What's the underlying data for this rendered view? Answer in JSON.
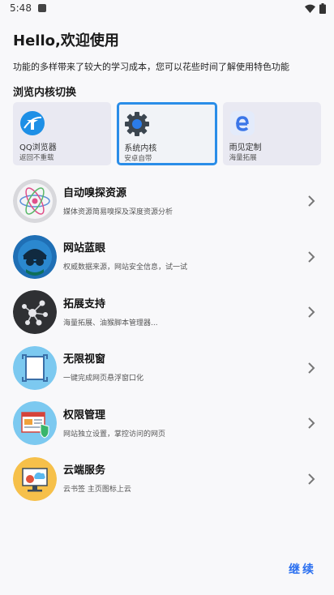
{
  "status_bar": {
    "time": "5:48"
  },
  "header": {
    "title": "Hello,欢迎使用",
    "subtitle": "功能的多样带来了较大的学习成本，您可以花些时间了解使用特色功能"
  },
  "kernel_section": {
    "title": "浏览内核切换",
    "options": [
      {
        "name": "QQ浏览器",
        "desc": "返回不重载",
        "icon": "qq-browser-icon"
      },
      {
        "name": "系统内核",
        "desc": "安卓自带",
        "icon": "gear-icon",
        "selected": true
      },
      {
        "name": "雨见定制",
        "desc": "海量拓展",
        "icon": "e-browser-icon"
      }
    ]
  },
  "features": [
    {
      "name": "自动嗅探资源",
      "desc": "媒体资源简易嗅探及深度资源分析",
      "icon": "atom-icon",
      "color": "#d8d8dc"
    },
    {
      "name": "网站蓝眼",
      "desc": "权威数据来源，网站安全信息，试一试",
      "icon": "spy-icon",
      "color": "#1f6fb5"
    },
    {
      "name": "拓展支持",
      "desc": "海量拓展、油猴脚本管理器...",
      "icon": "network-icon",
      "color": "#2f3033"
    },
    {
      "name": "无限视窗",
      "desc": "一键完成网页悬浮窗口化",
      "icon": "window-icon",
      "color": "#7cc9f0"
    },
    {
      "name": "权限管理",
      "desc": "网站独立设置，掌控访问的网页",
      "icon": "shield-browser-icon",
      "color": "#7cc9f0"
    },
    {
      "name": "云端服务",
      "desc": "云书签 主页图标上云",
      "icon": "cloud-monitor-icon",
      "color": "#f6c04a"
    }
  ],
  "continue_label": "继续",
  "colors": {
    "accent": "#2a8de8",
    "continue": "#2a6ff0"
  }
}
